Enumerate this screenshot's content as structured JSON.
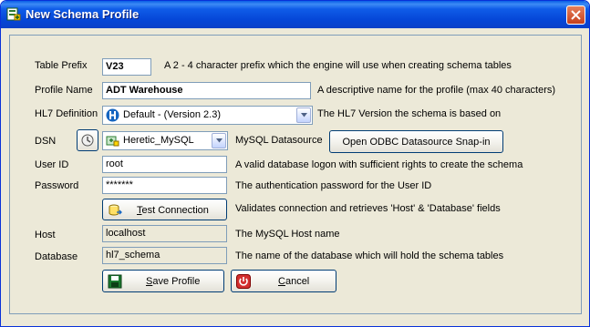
{
  "window": {
    "title": "New Schema Profile"
  },
  "form": {
    "table_prefix": {
      "label": "Table Prefix",
      "value": "V23",
      "description": "A 2 - 4 character prefix which the engine will use when creating schema tables"
    },
    "profile_name": {
      "label": "Profile Name",
      "value": "ADT Warehouse",
      "description": "A descriptive name for the profile (max 40 characters)"
    },
    "hl7_definition": {
      "label": "HL7 Definition",
      "selected": "Default - (Version 2.3)",
      "description": "The HL7 Version the schema is based on"
    },
    "dsn": {
      "label": "DSN",
      "selected": "Heretic_MySQL",
      "description": "MySQL Datasource",
      "snapin_button": "Open ODBC Datasource Snap-in"
    },
    "user_id": {
      "label": "User ID",
      "value": "root",
      "description": "A valid database logon with sufficient rights to create the schema"
    },
    "password": {
      "label": "Password",
      "value": "*******",
      "description": "The authentication password for the User ID"
    },
    "test_connection": {
      "label_prefix": "T",
      "label_rest": "est Connection",
      "description": "Validates connection and retrieves 'Host' & 'Database' fields"
    },
    "host": {
      "label": "Host",
      "value": "localhost",
      "description": "The MySQL Host name"
    },
    "database": {
      "label": "Database",
      "value": "hl7_schema",
      "description": "The name of the database which will hold the schema tables"
    }
  },
  "actions": {
    "save": {
      "label_prefix": "S",
      "label_rest": "ave Profile"
    },
    "cancel": {
      "label_prefix": "C",
      "label_rest": "ancel"
    }
  },
  "colors": {
    "title_bar": "#0546d7",
    "close_button": "#c6401c",
    "dialog_bg": "#ece9d8",
    "field_border": "#7f9db9"
  }
}
